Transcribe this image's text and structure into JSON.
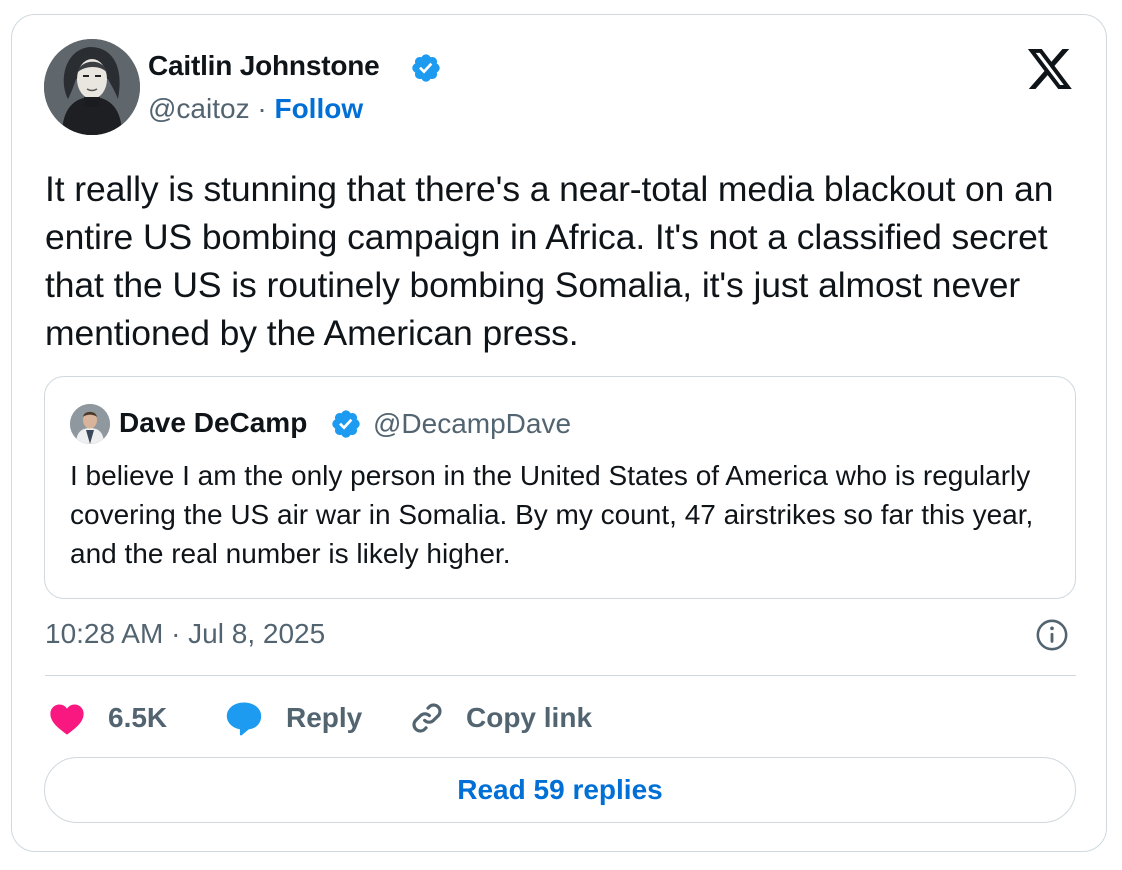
{
  "author": {
    "name": "Caitlin Johnstone",
    "handle": "@caitoz",
    "separator": "·",
    "follow_label": "Follow"
  },
  "tweet": {
    "text": "It really is stunning that there's a near-total media blackout on an entire US bombing campaign in Africa. It's not a classified secret that the US is routinely bombing Somalia, it's just almost never mentioned by the American press.",
    "timestamp": "10:28 AM · Jul 8, 2025"
  },
  "quoted_tweet": {
    "name": "Dave DeCamp",
    "handle": "@DecampDave",
    "text": "I believe I am the only person in the United States of America who is regularly covering the US air war in Somalia. By my count, 47 airstrikes so far this year, and the real number is likely higher."
  },
  "actions": {
    "like_count": "6.5K",
    "reply_label": "Reply",
    "copy_link_label": "Copy link"
  },
  "read_replies_label": "Read 59 replies",
  "icons": {
    "verified": "verified-badge-icon",
    "brand": "x-logo-icon",
    "info": "info-icon",
    "like": "heart-icon",
    "reply": "speech-bubble-icon",
    "copy_link": "link-icon"
  },
  "colors": {
    "accent": "#1d9bf0",
    "link": "#006fd6",
    "like": "#f91880",
    "text": "#0f1419",
    "secondary": "#536471",
    "border": "#cfd9de"
  }
}
